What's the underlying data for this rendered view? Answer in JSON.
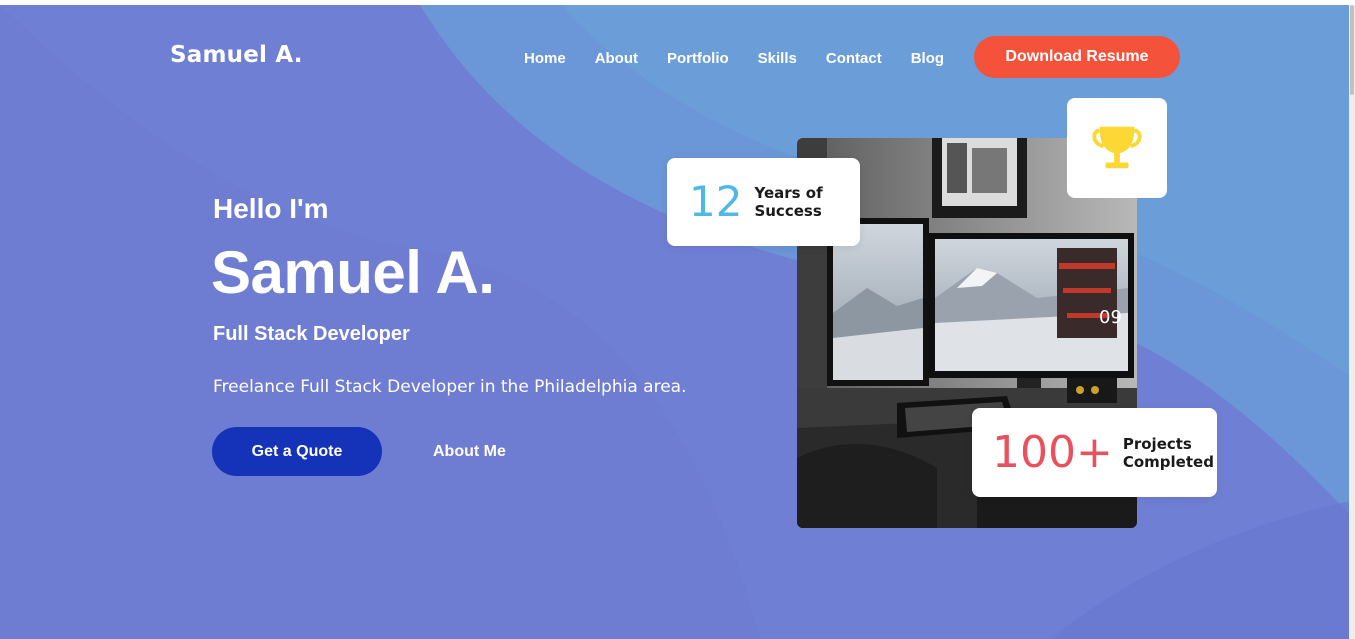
{
  "header": {
    "logo": "Samuel A.",
    "nav": [
      "Home",
      "About",
      "Portfolio",
      "Skills",
      "Contact",
      "Blog"
    ],
    "cta_label": "Download Resume"
  },
  "hero": {
    "greeting": "Hello I'm",
    "name": "Samuel A.",
    "role": "Full Stack Developer",
    "description": "Freelance Full Stack Developer in the Philadelphia area.",
    "primary_button": "Get a Quote",
    "secondary_link": "About Me"
  },
  "stats": {
    "years": {
      "number": "12",
      "line1": "Years of",
      "line2": "Success"
    },
    "projects": {
      "number": "100+",
      "line1": "Projects",
      "line2": "Completed"
    }
  },
  "icons": {
    "trophy": "trophy-icon"
  },
  "colors": {
    "background": "#6f7fd3",
    "resume_button": "#f4523b",
    "quote_button": "#1433b8",
    "years_number": "#4fb8e6",
    "projects_number": "#e8515d",
    "trophy": "#fdd835"
  }
}
